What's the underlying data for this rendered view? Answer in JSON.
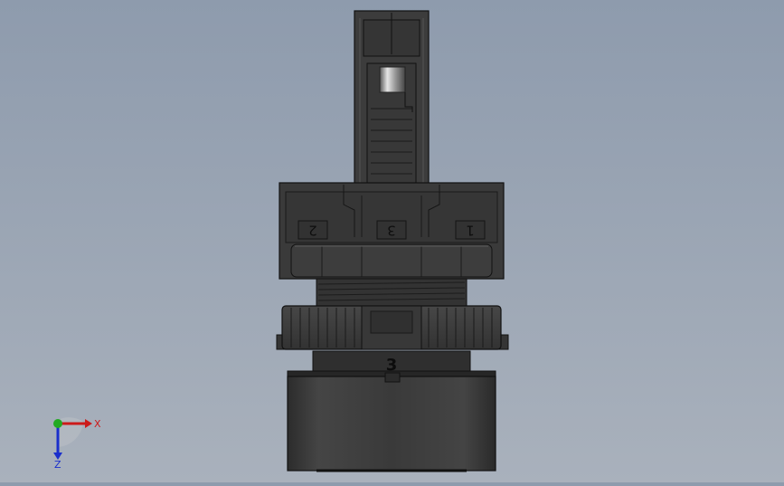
{
  "viewport": {
    "background_top": "#8e9bad",
    "background_bottom": "#a9b1bc"
  },
  "model": {
    "body_color": "#3b3b3b",
    "dark_color": "#2a2a2a",
    "edge_color": "#111111",
    "highlight_color": "#6a6a6a",
    "terminal_labels": [
      "2",
      "3",
      "1"
    ],
    "front_marking": "3"
  },
  "triad": {
    "x_label": "X",
    "z_label": "Z",
    "x_color": "#cc1a1a",
    "y_color": "#22aa22",
    "z_color": "#1a2fcc"
  }
}
